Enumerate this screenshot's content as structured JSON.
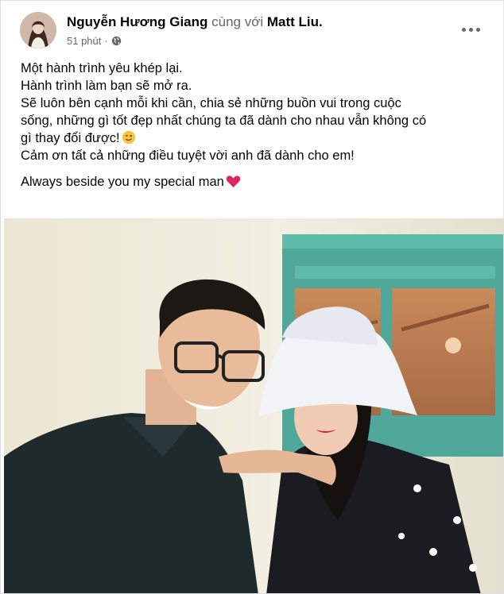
{
  "post": {
    "author": "Nguyễn Hương Giang",
    "with_text": "cùng với",
    "tagged": "Matt Liu.",
    "time": "51 phút",
    "separator": "·",
    "privacy_icon": "globe-icon",
    "more_icon": "more-horizontal-icon",
    "lines": [
      "Một hành trình yêu khép lại.",
      "Hành trình làm bạn sẽ mở ra.",
      "Sẽ luôn bên cạnh mỗi khi cần, chia sẻ những buồn vui trong cuộc",
      "sống, những gì tốt đẹp nhất chúng ta đã dành cho nhau vẫn không có",
      "gì thay đổi được!",
      "Cảm ơn tất cả những điều tuyệt vời anh đã dành cho em!",
      "Always beside you my special man"
    ],
    "emoji": {
      "wink": "winking-face-icon",
      "heart": "red-heart-icon"
    }
  },
  "colors": {
    "text_primary": "#050505",
    "text_secondary": "#65676b",
    "window_frame": "#4fa89a",
    "heart": "#e0245e",
    "emoji_yellow": "#f7c23b"
  }
}
